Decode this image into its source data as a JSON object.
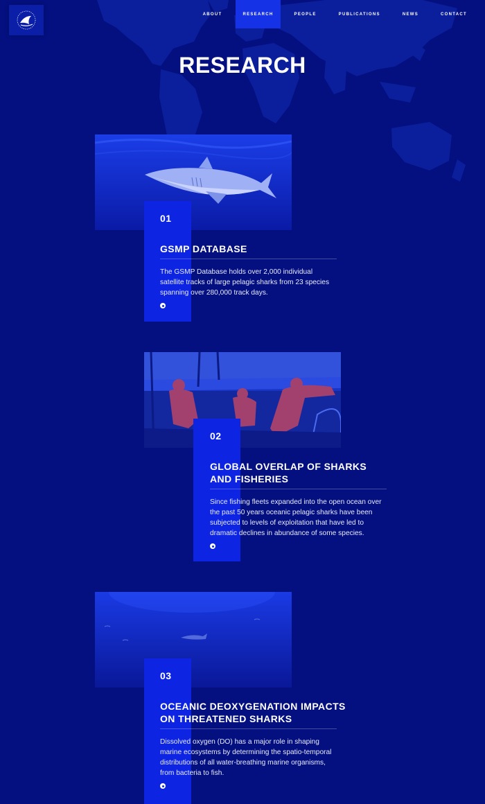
{
  "nav": {
    "items": [
      {
        "label": "ABOUT"
      },
      {
        "label": "RESEARCH"
      },
      {
        "label": "PEOPLE"
      },
      {
        "label": "PUBLICATIONS"
      },
      {
        "label": "NEWS"
      },
      {
        "label": "CONTACT"
      }
    ],
    "active": "RESEARCH"
  },
  "page": {
    "title": "RESEARCH"
  },
  "cards": [
    {
      "number": "01",
      "title": "GSMP DATABASE",
      "text": "The GSMP Database holds over 2,000 individual satellite tracks of large pelagic sharks from 23 species spanning over 280,000 track days.",
      "image": "shark-photo"
    },
    {
      "number": "02",
      "title": "GLOBAL OVERLAP OF SHARKS AND FISHERIES",
      "text": "Since fishing fleets expanded into the open ocean over the past 50 years oceanic pelagic sharks have been subjected to levels of exploitation that have led to dramatic declines in abundance of some species.",
      "image": "fishermen-photo"
    },
    {
      "number": "03",
      "title": "OCEANIC DEOXYGENATION IMPACTS ON THREATENED SHARKS",
      "text": "Dissolved oxygen (DO) has a major role in shaping marine ecosystems by determining the spatio-temporal distributions of all water-breathing marine organisms, from bacteria to fish.",
      "image": "deep-ocean-photo"
    }
  ],
  "colors": {
    "background": "#04107f",
    "accent": "#0d25e3",
    "nav_active": "#1532e6"
  }
}
